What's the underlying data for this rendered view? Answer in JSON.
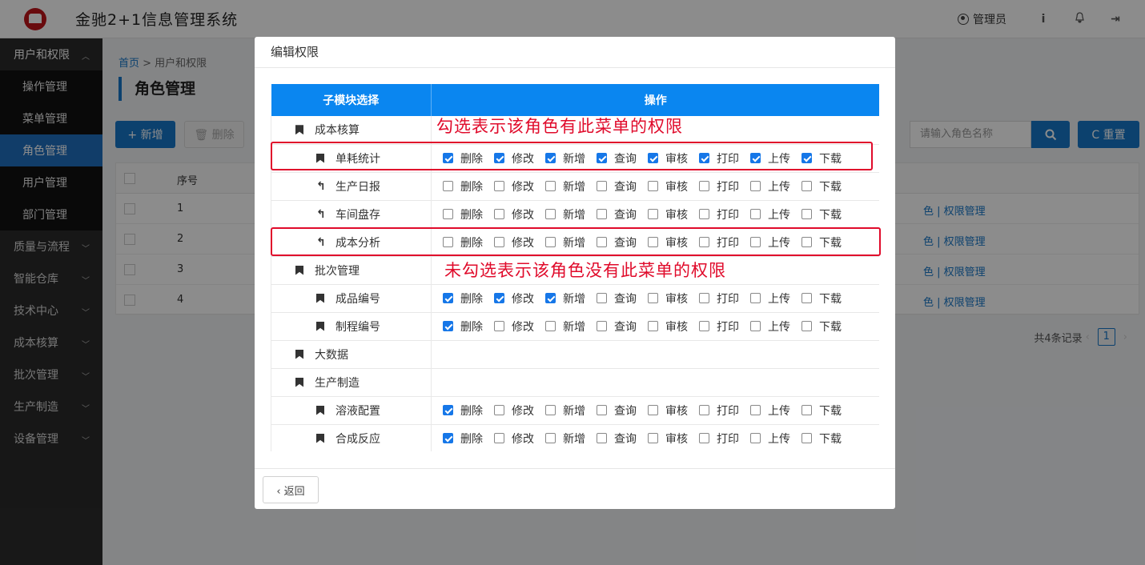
{
  "app": {
    "title": "金驰2+1信息管理系统",
    "user": "管理员",
    "info_icon": "i",
    "bell_icon": "🔔",
    "logout_icon": "⇥"
  },
  "sidebar": {
    "groups": [
      {
        "label": "用户和权限",
        "open": true,
        "items": [
          "操作管理",
          "菜单管理",
          "角色管理",
          "用户管理",
          "部门管理"
        ],
        "active": "角色管理"
      },
      {
        "label": "质量与流程"
      },
      {
        "label": "智能仓库"
      },
      {
        "label": "技术中心"
      },
      {
        "label": "成本核算"
      },
      {
        "label": "批次管理"
      },
      {
        "label": "生产制造"
      },
      {
        "label": "设备管理"
      }
    ]
  },
  "main": {
    "breadcrumb_home": "首页",
    "breadcrumb_rest": " > 用户和权限",
    "page_title": "角色管理",
    "add_label": "+ 新增",
    "delete_label": "🗑 删除",
    "search_placeholder": "请输入角色名称",
    "reset_label": "C 重置",
    "table_header_seq": "序号",
    "rows": [
      {
        "seq": "1",
        "link": "色  |  权限管理"
      },
      {
        "seq": "2",
        "link": "色  |  权限管理"
      },
      {
        "seq": "3",
        "link": "色  |  权限管理"
      },
      {
        "seq": "4",
        "link": "色  |  权限管理"
      }
    ],
    "total": "共4条记录",
    "page": "1"
  },
  "modal": {
    "title": "编辑权限",
    "col_module": "子模块选择",
    "col_ops": "操作",
    "back_label": "‹ 返回",
    "op_labels": [
      "删除",
      "修改",
      "新增",
      "查询",
      "审核",
      "打印",
      "上传",
      "下载"
    ],
    "rows": [
      {
        "name": "成本核算",
        "level": 1,
        "icon": "bookmark",
        "ops": null
      },
      {
        "name": "单耗统计",
        "level": 2,
        "icon": "bookmark",
        "ops": [
          true,
          true,
          true,
          true,
          true,
          true,
          true,
          true
        ]
      },
      {
        "name": "生产日报",
        "level": 2,
        "icon": "arrow",
        "ops": [
          false,
          false,
          false,
          false,
          false,
          false,
          false,
          false
        ]
      },
      {
        "name": "车间盘存",
        "level": 2,
        "icon": "arrow",
        "ops": [
          false,
          false,
          false,
          false,
          false,
          false,
          false,
          false
        ]
      },
      {
        "name": "成本分析",
        "level": 2,
        "icon": "arrow",
        "ops": [
          false,
          false,
          false,
          false,
          false,
          false,
          false,
          false
        ]
      },
      {
        "name": "批次管理",
        "level": 1,
        "icon": "bookmark",
        "ops": null
      },
      {
        "name": "成品编号",
        "level": 2,
        "icon": "bookmark",
        "ops": [
          true,
          true,
          true,
          false,
          false,
          false,
          false,
          false
        ]
      },
      {
        "name": "制程编号",
        "level": 2,
        "icon": "bookmark",
        "ops": [
          true,
          false,
          false,
          false,
          false,
          false,
          false,
          false
        ]
      },
      {
        "name": "大数据",
        "level": 1,
        "icon": "bookmark",
        "ops": null
      },
      {
        "name": "生产制造",
        "level": 1,
        "icon": "bookmark",
        "ops": null
      },
      {
        "name": "溶液配置",
        "level": 2,
        "icon": "bookmark",
        "ops": [
          true,
          false,
          false,
          false,
          false,
          false,
          false,
          false
        ]
      },
      {
        "name": "合成反应",
        "level": 2,
        "icon": "bookmark",
        "ops": [
          true,
          false,
          false,
          false,
          false,
          false,
          false,
          false
        ]
      }
    ]
  },
  "annotations": {
    "checked_note": "勾选表示该角色有此菜单的权限",
    "unchecked_note": "未勾选表示该角色没有此菜单的权限",
    "color": "#e00b2b"
  }
}
